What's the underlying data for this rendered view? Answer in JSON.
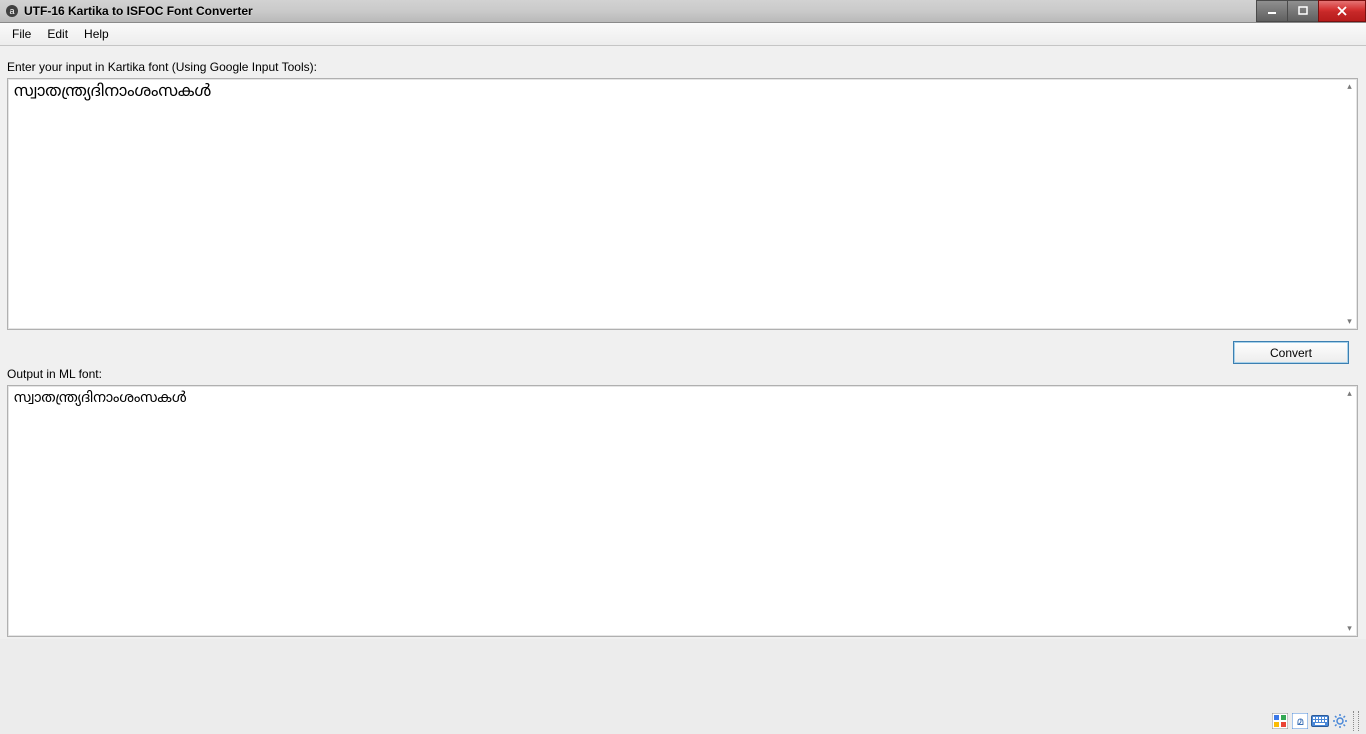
{
  "window": {
    "title": "UTF-16 Kartika to ISFOC Font Converter"
  },
  "menu": {
    "file": "File",
    "edit": "Edit",
    "help": "Help"
  },
  "labels": {
    "input": "Enter your input in Kartika font (Using Google Input Tools):",
    "output": "Output in ML font:"
  },
  "fields": {
    "input_text": "സ്വാതന്ത്ര്യദിനാംശംസകൾ",
    "output_text": "സ്വാതന്ത്ര്യദിനാംശംസകൾ"
  },
  "buttons": {
    "convert": "Convert"
  }
}
